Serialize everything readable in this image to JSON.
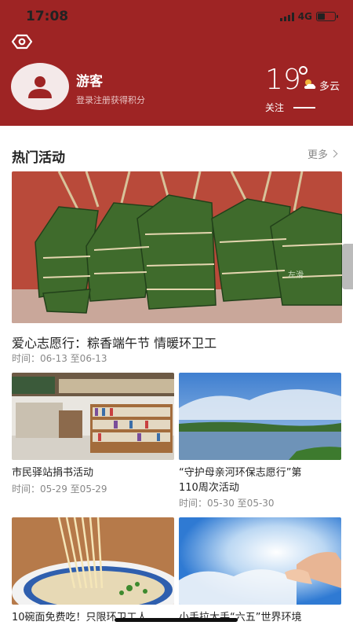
{
  "status_bar": {
    "time": "17:08",
    "network": "4G",
    "battery_level": 0.45
  },
  "profile": {
    "name": "游客",
    "subtitle": "登录注册获得积分"
  },
  "weather": {
    "temperature": "19",
    "condition": "多云",
    "follow_label": "关注"
  },
  "section": {
    "title": "热门活动",
    "more_label": "更多"
  },
  "hero": {
    "title": "爱心志愿行：粽香端午节  情暖环卫工",
    "time": "时间：06-13 至06-13",
    "image_text": "左滑"
  },
  "cards": [
    {
      "title": "市民驿站捐书活动",
      "time": "时间：05-29 至05-29"
    },
    {
      "title_line1": "“守护母亲河环保志愿行”第",
      "title_line2": "110周次活动",
      "time": "时间：05-30 至05-30"
    },
    {
      "title": "10碗面免费吃！只限环卫工人"
    },
    {
      "title": "小手拉大手“六五”世界环境"
    }
  ],
  "colors": {
    "header_bg": "#9e2424",
    "text_primary": "#222222",
    "text_secondary": "#888888"
  }
}
